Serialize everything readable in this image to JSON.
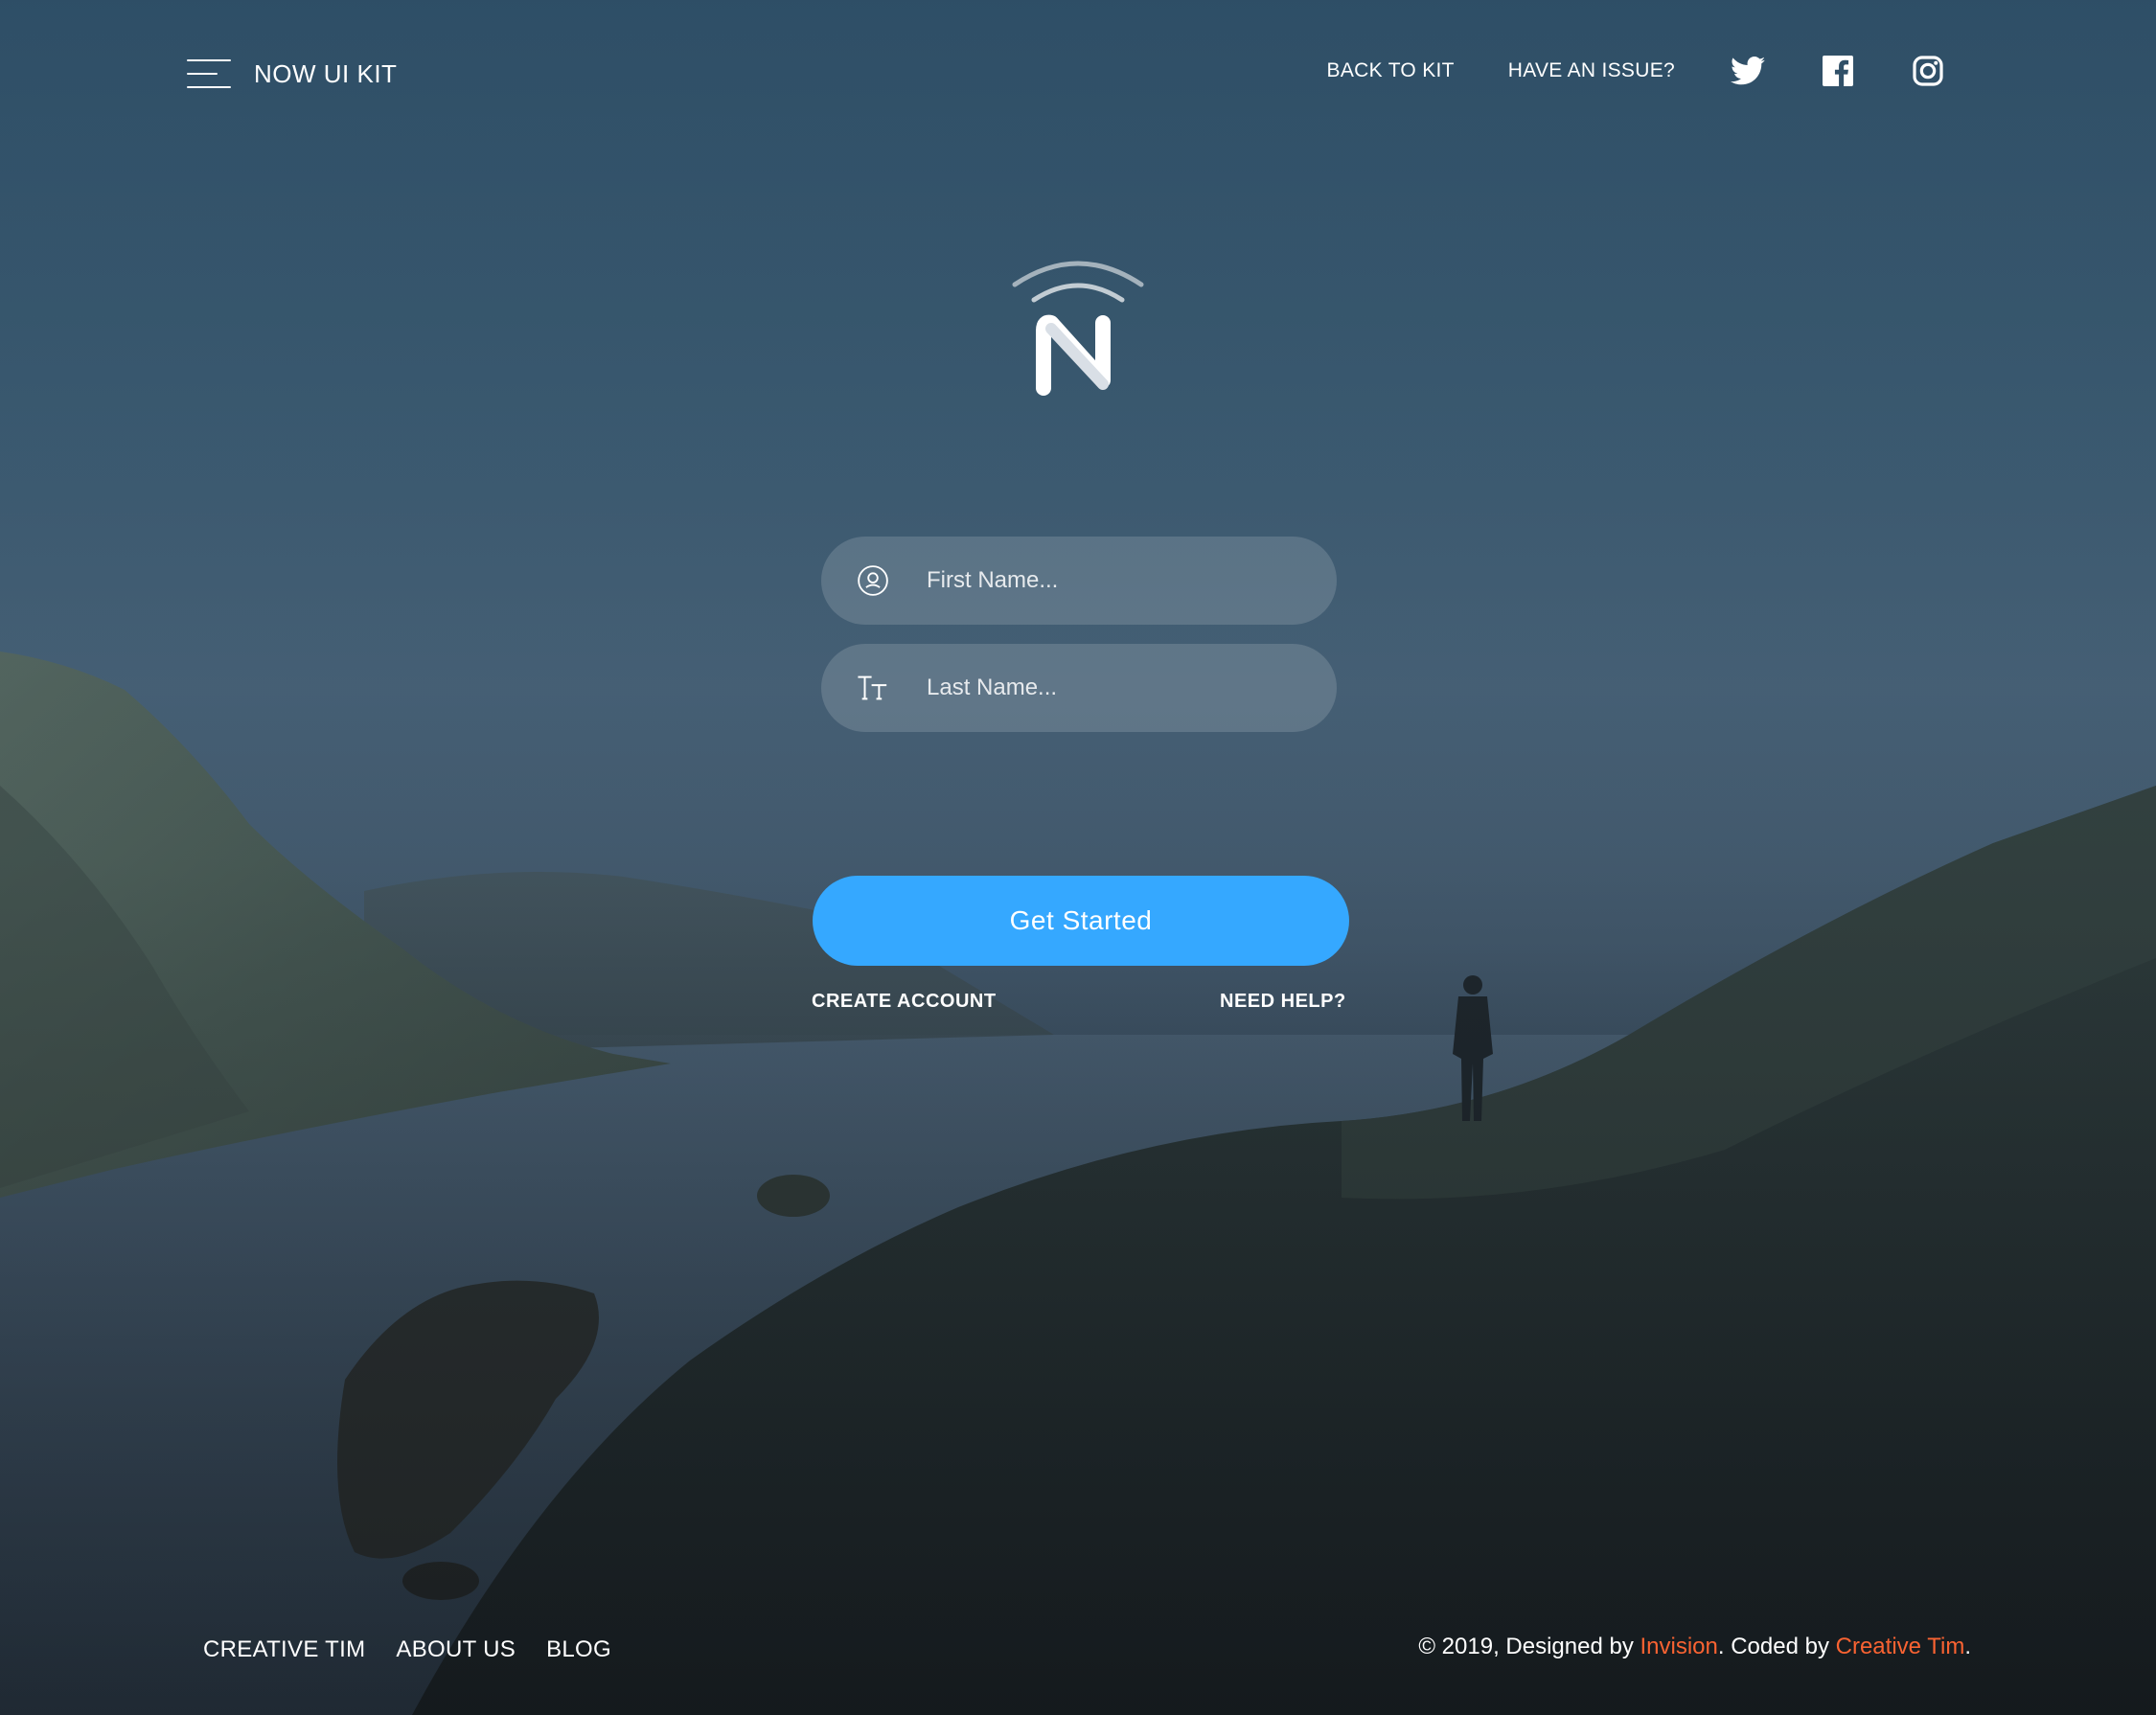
{
  "navbar": {
    "brand": "NOW UI KIT",
    "links": [
      "BACK TO KIT",
      "HAVE AN ISSUE?"
    ],
    "icons": [
      "twitter-icon",
      "facebook-icon",
      "instagram-icon"
    ]
  },
  "form": {
    "first_name_placeholder": "First Name...",
    "last_name_placeholder": "Last Name...",
    "submit_label": "Get Started",
    "create_account": "CREATE ACCOUNT",
    "need_help": "NEED HELP?"
  },
  "footer": {
    "links": [
      "CREATIVE TIM",
      "ABOUT US",
      "BLOG"
    ],
    "copyright_prefix": "© 2019, Designed by ",
    "designer": "Invision",
    "copyright_middle": ". Coded by ",
    "coder": "Creative Tim",
    "copyright_suffix": "."
  },
  "colors": {
    "primary": "#35a8ff",
    "accent": "#f96332"
  }
}
